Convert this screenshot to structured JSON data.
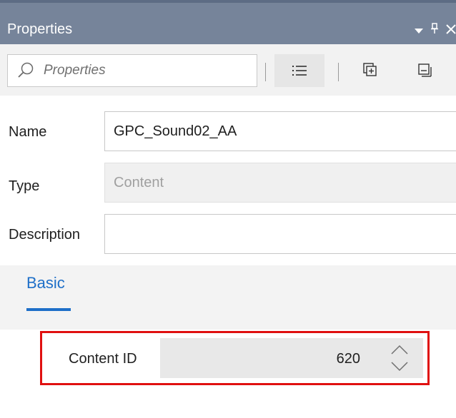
{
  "panel": {
    "title": "Properties",
    "controls": {
      "dropdown_icon": "caret-down-icon",
      "pin_icon": "pin-icon",
      "close_icon": "close-icon"
    }
  },
  "toolbar": {
    "search": {
      "placeholder": "Properties",
      "value": ""
    },
    "buttons": [
      {
        "name": "list-view-button",
        "icon": "list-icon"
      },
      {
        "name": "expand-all-button",
        "icon": "expand-icon"
      },
      {
        "name": "collapse-all-button",
        "icon": "collapse-icon"
      }
    ]
  },
  "fields": {
    "name": {
      "label": "Name",
      "value": "GPC_Sound02_AA"
    },
    "type": {
      "label": "Type",
      "value": "Content"
    },
    "description": {
      "label": "Description",
      "value": ""
    }
  },
  "tabs": [
    {
      "label": "Basic",
      "active": true
    }
  ],
  "content_id": {
    "label": "Content ID",
    "value": "620"
  },
  "colors": {
    "titlebar": "#76849a",
    "accent": "#1e6fc8",
    "highlight": "#e01010"
  }
}
